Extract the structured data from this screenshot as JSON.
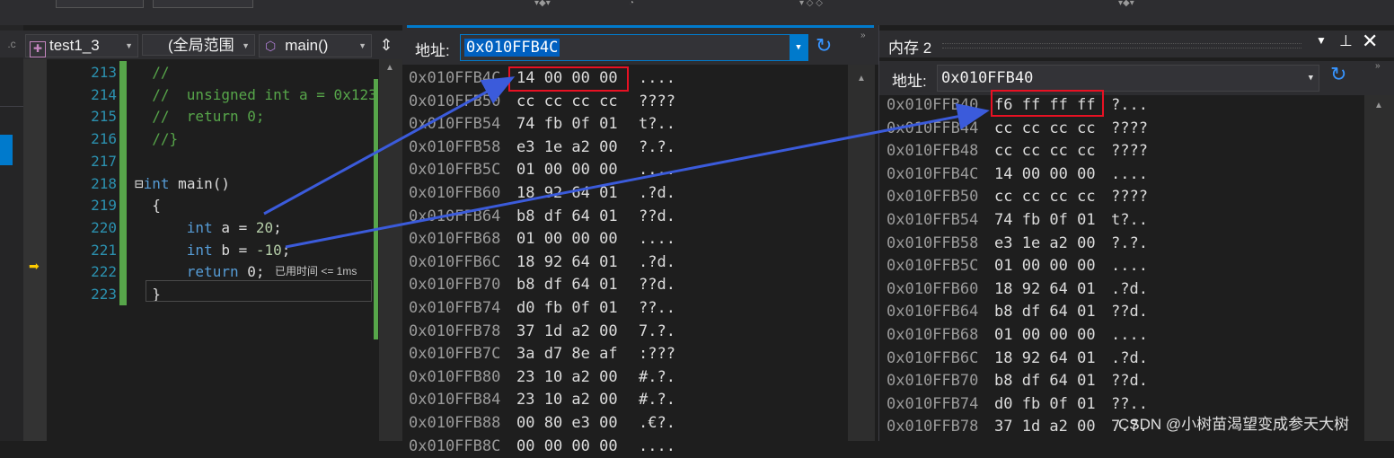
{
  "editor": {
    "project_dropdown": "test1_3",
    "scope_dropdown": "(全局范围",
    "function_dropdown": "main()",
    "lines": [
      {
        "num": "213",
        "parts": [
          [
            "cm",
            "  //"
          ]
        ]
      },
      {
        "num": "214",
        "parts": [
          [
            "cm",
            "  //  unsigned int a = 0x123"
          ]
        ]
      },
      {
        "num": "215",
        "parts": [
          [
            "cm",
            "  //  return 0;"
          ]
        ]
      },
      {
        "num": "216",
        "parts": [
          [
            "cm",
            "  //}"
          ]
        ]
      },
      {
        "num": "217",
        "parts": []
      },
      {
        "num": "218",
        "parts": [
          [
            "txt",
            "⊟"
          ],
          [
            "kw",
            "int"
          ],
          [
            "txt",
            " main()"
          ]
        ]
      },
      {
        "num": "219",
        "parts": [
          [
            "txt",
            "  {"
          ]
        ]
      },
      {
        "num": "220",
        "parts": [
          [
            "txt",
            "      "
          ],
          [
            "kw",
            "int"
          ],
          [
            "txt",
            " a = "
          ],
          [
            "num",
            "20"
          ],
          [
            "txt",
            ";"
          ]
        ]
      },
      {
        "num": "221",
        "parts": [
          [
            "txt",
            "      "
          ],
          [
            "kw",
            "int"
          ],
          [
            "txt",
            " b = "
          ],
          [
            "num",
            "-10"
          ],
          [
            "txt",
            ";"
          ]
        ]
      },
      {
        "num": "222",
        "parts": [
          [
            "txt",
            "      "
          ],
          [
            "kw",
            "return"
          ],
          [
            "txt",
            " 0;"
          ]
        ]
      },
      {
        "num": "223",
        "parts": [
          [
            "txt",
            "  }"
          ]
        ]
      }
    ],
    "perf_tip": "已用时间 <= 1ms"
  },
  "memory1": {
    "address_label": "地址:",
    "address_value": "0x010FFB4C",
    "rows": [
      [
        "0x010FFB4C",
        "14 00 00 00",
        "...."
      ],
      [
        "0x010FFB50",
        "cc cc cc cc",
        "????"
      ],
      [
        "0x010FFB54",
        "74 fb 0f 01",
        "t?.."
      ],
      [
        "0x010FFB58",
        "e3 1e a2 00",
        "?.?."
      ],
      [
        "0x010FFB5C",
        "01 00 00 00",
        "...."
      ],
      [
        "0x010FFB60",
        "18 92 64 01",
        ".?d."
      ],
      [
        "0x010FFB64",
        "b8 df 64 01",
        "??d."
      ],
      [
        "0x010FFB68",
        "01 00 00 00",
        "...."
      ],
      [
        "0x010FFB6C",
        "18 92 64 01",
        ".?d."
      ],
      [
        "0x010FFB70",
        "b8 df 64 01",
        "??d."
      ],
      [
        "0x010FFB74",
        "d0 fb 0f 01",
        "??.."
      ],
      [
        "0x010FFB78",
        "37 1d a2 00",
        "7.?."
      ],
      [
        "0x010FFB7C",
        "3a d7 8e af",
        ":???"
      ],
      [
        "0x010FFB80",
        "23 10 a2 00",
        "#.?."
      ],
      [
        "0x010FFB84",
        "23 10 a2 00",
        "#.?."
      ],
      [
        "0x010FFB88",
        "00 80 e3 00",
        ".€?."
      ],
      [
        "0x010FFB8C",
        "00 00 00 00",
        "...."
      ]
    ]
  },
  "memory2": {
    "title": "内存 2",
    "address_label": "地址:",
    "address_value": "0x010FFB40",
    "rows": [
      [
        "0x010FFB40",
        "f6 ff ff ff",
        "?..."
      ],
      [
        "0x010FFB44",
        "cc cc cc cc",
        "????"
      ],
      [
        "0x010FFB48",
        "cc cc cc cc",
        "????"
      ],
      [
        "0x010FFB4C",
        "14 00 00 00",
        "...."
      ],
      [
        "0x010FFB50",
        "cc cc cc cc",
        "????"
      ],
      [
        "0x010FFB54",
        "74 fb 0f 01",
        "t?.."
      ],
      [
        "0x010FFB58",
        "e3 1e a2 00",
        "?.?."
      ],
      [
        "0x010FFB5C",
        "01 00 00 00",
        "...."
      ],
      [
        "0x010FFB60",
        "18 92 64 01",
        ".?d."
      ],
      [
        "0x010FFB64",
        "b8 df 64 01",
        "??d."
      ],
      [
        "0x010FFB68",
        "01 00 00 00",
        "...."
      ],
      [
        "0x010FFB6C",
        "18 92 64 01",
        ".?d."
      ],
      [
        "0x010FFB70",
        "b8 df 64 01",
        "??d."
      ],
      [
        "0x010FFB74",
        "d0 fb 0f 01",
        "??.."
      ],
      [
        "0x010FFB78",
        "37 1d a2 00",
        "7.?."
      ]
    ]
  },
  "watermark": "CSDN @小树苗渴望变成参天大树",
  "colors": {
    "keyword": "#569cd6",
    "comment": "#57a64a",
    "number": "#b5cea8",
    "highlight_box": "#e81123",
    "arrow": "#3b5bdb",
    "accent": "#007acc"
  }
}
